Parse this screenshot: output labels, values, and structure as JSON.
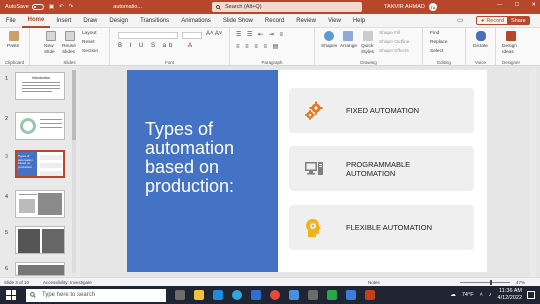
{
  "titlebar": {
    "autosave_label": "AutoSave",
    "toggle_state": "Off",
    "filename": "automatio...",
    "search_label": "Search (Alt+Q)",
    "user_name": "TANVIR AHMAD",
    "user_initials": "TA"
  },
  "menu": {
    "tabs": [
      "File",
      "Home",
      "Insert",
      "Draw",
      "Design",
      "Transitions",
      "Animations",
      "Slide Show",
      "Record",
      "Review",
      "View",
      "Help"
    ],
    "active": "Home",
    "record_label": "Record",
    "share_label": "Share"
  },
  "ribbon": {
    "groups": {
      "clipboard": "Clipboard",
      "slides": "Slides",
      "font": "Font",
      "paragraph": "Paragraph",
      "drawing": "Drawing",
      "editing": "Editing",
      "voice": "Voice",
      "designer": "Designer"
    },
    "paste": "Paste",
    "new_slide": "New Slide",
    "reuse_slides": "Reuse Slides",
    "layout": "Layout",
    "reset": "Reset",
    "section": "Section",
    "shapes": "Shapes",
    "arrange": "Arrange",
    "quick_styles": "Quick Styles",
    "shape_fill": "Shape Fill",
    "shape_outline": "Shape Outline",
    "shape_effects": "Shape Effects",
    "find": "Find",
    "replace": "Replace",
    "select": "Select",
    "dictate": "Dictate",
    "design_ideas": "Design Ideas"
  },
  "thumbnails": [
    {
      "num": "1",
      "title": "Introduction"
    },
    {
      "num": "2",
      "title": ""
    },
    {
      "num": "3",
      "title": "Types of automation based on production"
    },
    {
      "num": "4",
      "title": ""
    },
    {
      "num": "5",
      "title": ""
    },
    {
      "num": "6",
      "title": ""
    }
  ],
  "slide": {
    "title": "Types of automation based on production:",
    "items": [
      {
        "label": "FIXED AUTOMATION",
        "icon": "gears-icon"
      },
      {
        "label": "PROGRAMMABLE AUTOMATION",
        "icon": "computer-icon"
      },
      {
        "label": "FLEXIBLE AUTOMATION",
        "icon": "head-gear-icon"
      }
    ],
    "colors": {
      "accent": "#4472c4",
      "app": "#b7472a",
      "orange": "#e07a1f",
      "yellow": "#f2b21c"
    }
  },
  "status": {
    "slide_counter": "Slide 3 of 10",
    "accessibility": "Accessibility: Investigate",
    "notes": "Notes",
    "zoom": "47%"
  },
  "taskbar": {
    "search_placeholder": "Type here to search",
    "weather": "74°F",
    "time": "11:36 AM",
    "date": "4/12/2022"
  }
}
